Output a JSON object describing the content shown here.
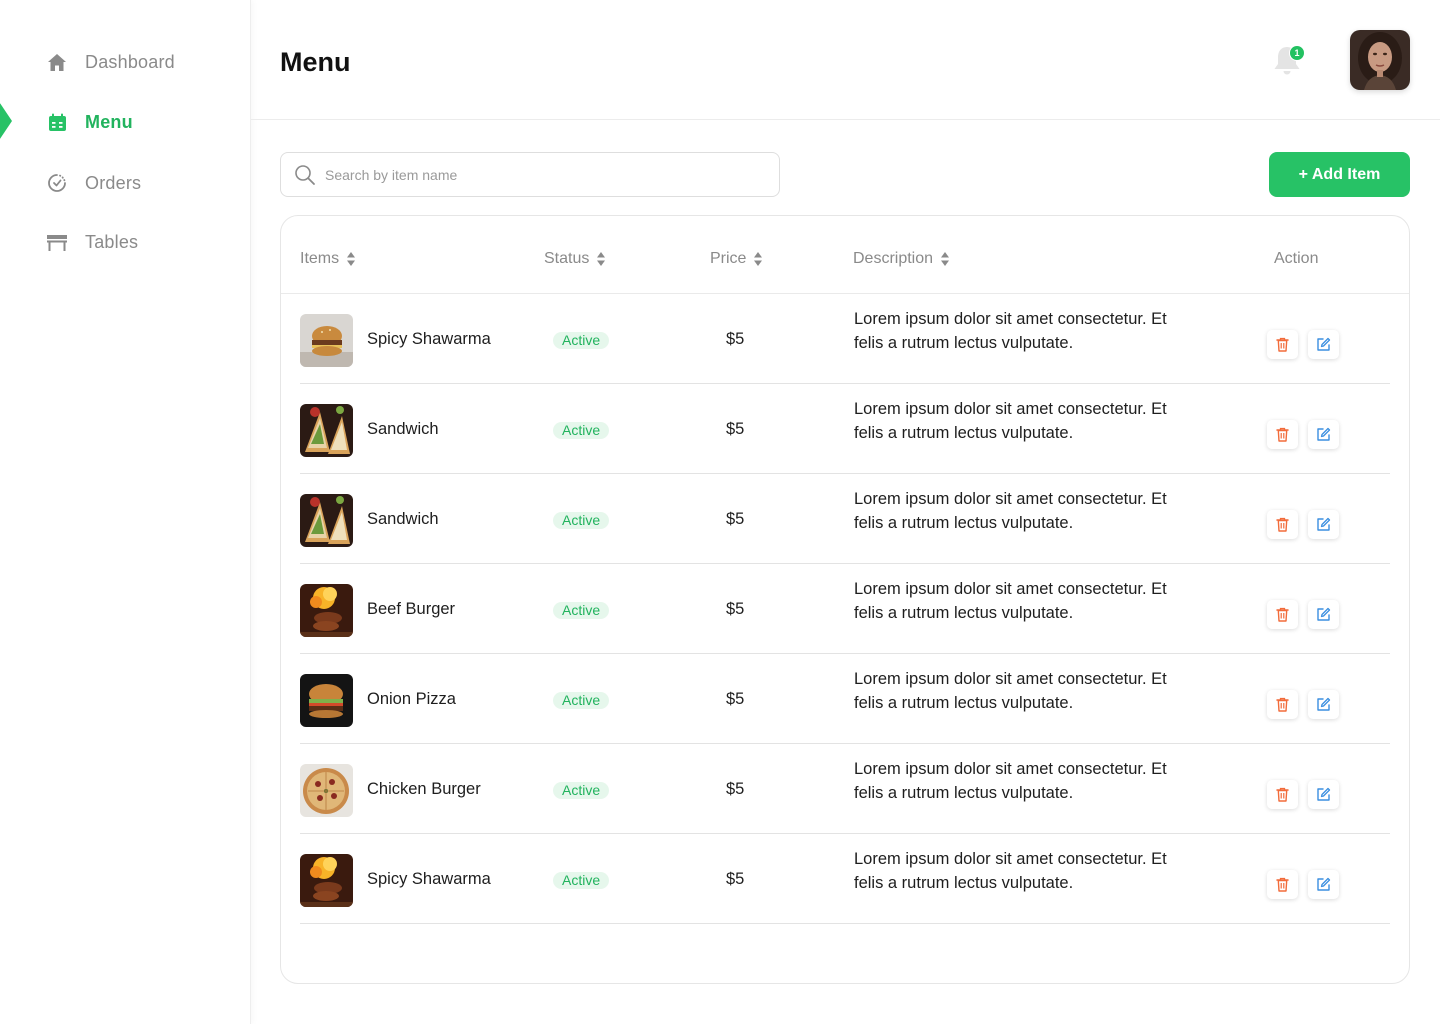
{
  "sidebar": {
    "items": [
      {
        "label": "Dashboard",
        "icon": "home-icon",
        "active": false
      },
      {
        "label": "Menu",
        "icon": "calendar-icon",
        "active": true
      },
      {
        "label": "Orders",
        "icon": "orders-dial-icon",
        "active": false
      },
      {
        "label": "Tables",
        "icon": "table-icon",
        "active": false
      }
    ]
  },
  "header": {
    "title": "Menu",
    "notification_count": "1"
  },
  "toolbar": {
    "search_placeholder": "Search by item name",
    "search_value": "",
    "add_label": "+ Add Item"
  },
  "table": {
    "columns": [
      "Items",
      "Status",
      "Price",
      "Description",
      "Action"
    ],
    "rows": [
      {
        "name": "Spicy Shawarma",
        "image": "burger-photo",
        "status": "Active",
        "price": "$5",
        "description": "Lorem ipsum dolor sit amet consectetur. Et felis a rutrum lectus vulputate."
      },
      {
        "name": "Sandwich",
        "image": "sandwich-photo",
        "status": "Active",
        "price": "$5",
        "description": "Lorem ipsum dolor sit amet consectetur. Et felis a rutrum lectus vulputate."
      },
      {
        "name": "Sandwich",
        "image": "sandwich-photo",
        "status": "Active",
        "price": "$5",
        "description": "Lorem ipsum dolor sit amet consectetur. Et felis a rutrum lectus vulputate."
      },
      {
        "name": "Beef Burger",
        "image": "grilled-meat-photo",
        "status": "Active",
        "price": "$5",
        "description": "Lorem ipsum dolor sit amet consectetur. Et felis a rutrum lectus vulputate."
      },
      {
        "name": "Onion Pizza",
        "image": "burger-dark-photo",
        "status": "Active",
        "price": "$5",
        "description": "Lorem ipsum dolor sit amet consectetur. Et felis a rutrum lectus vulputate."
      },
      {
        "name": "Chicken Burger",
        "image": "pizza-photo",
        "status": "Active",
        "price": "$5",
        "description": "Lorem ipsum dolor sit amet consectetur. Et felis a rutrum lectus vulputate."
      },
      {
        "name": "Spicy Shawarma",
        "image": "grilled-meat-photo",
        "status": "Active",
        "price": "$5",
        "description": "Lorem ipsum dolor sit amet consectetur. Et felis a rutrum lectus vulputate."
      }
    ]
  },
  "colors": {
    "accent": "#27c266",
    "status_bg": "#e6f7ec",
    "delete": "#f26b3a",
    "edit": "#3b8fe0",
    "muted_text": "#8a8a8a"
  }
}
